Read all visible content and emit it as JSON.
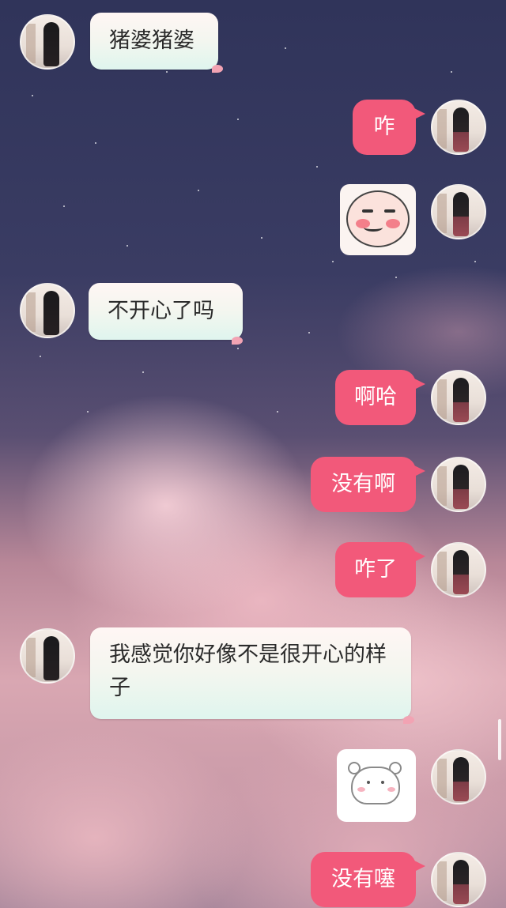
{
  "chat": {
    "messages": [
      {
        "side": "left",
        "type": "text",
        "text": "猪婆猪婆"
      },
      {
        "side": "right",
        "type": "text",
        "text": "咋"
      },
      {
        "side": "right",
        "type": "sticker",
        "sticker": "blushing-face-sticker"
      },
      {
        "side": "left",
        "type": "text",
        "text": "不开心了吗"
      },
      {
        "side": "right",
        "type": "text",
        "text": "啊哈"
      },
      {
        "side": "right",
        "type": "text",
        "text": "没有啊"
      },
      {
        "side": "right",
        "type": "text",
        "text": "咋了"
      },
      {
        "side": "left",
        "type": "text",
        "text": "我感觉你好像不是很开心的样子"
      },
      {
        "side": "right",
        "type": "sticker",
        "sticker": "bear-sticker"
      },
      {
        "side": "right",
        "type": "text",
        "text": "没有噻"
      }
    ]
  },
  "colors": {
    "right_bubble": "#f2597a",
    "left_bubble": "#f3f6ef"
  }
}
